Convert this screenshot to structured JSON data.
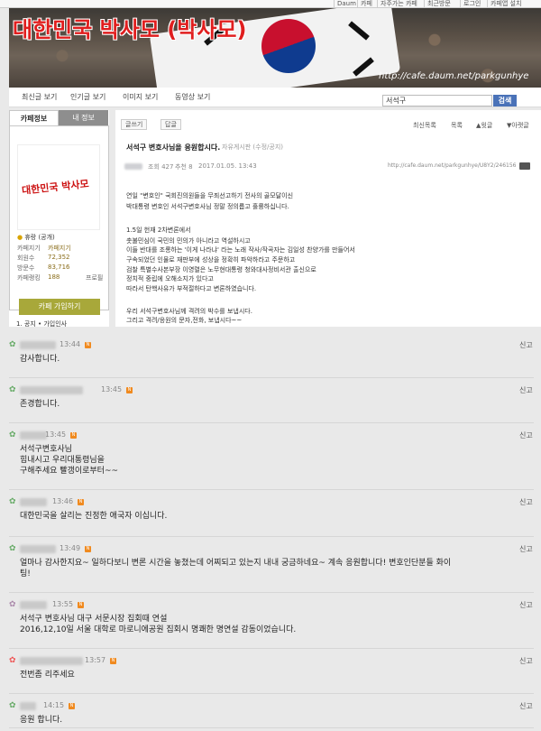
{
  "topbar": {
    "links": [
      "Daum",
      "카페",
      "자주가는 카페",
      "최근방문",
      "로그인",
      "카페앱 설치"
    ]
  },
  "banner": {
    "title": "대한민국 박사모 (박사모)",
    "url": "http://cafe.daum.net/parkgunhye"
  },
  "tabs": [
    "최신글 보기",
    "인기글 보기",
    "이미지 보기",
    "동영상 보기"
  ],
  "search": {
    "value": "서석구",
    "button": "검색"
  },
  "sidebar": {
    "tab_info": "카페정보",
    "tab_mine": "내 정보",
    "logo_text": "대한민국 박사모",
    "manager": "휴랑 (공개)",
    "rows": [
      {
        "label": "카페지기",
        "value": "카페지기"
      },
      {
        "label": "회원수",
        "value": "72,352"
      },
      {
        "label": "방문수",
        "value": "83,716"
      },
      {
        "label": "카페랭킹",
        "value": "188"
      }
    ],
    "promo": "프로필",
    "join": "카페 가입하기",
    "first_menu": "1. 공지 • 가입인사"
  },
  "post": {
    "write_btn": "글쓰기",
    "reply_btn": "답글",
    "top_links": [
      "최신목록",
      "목록",
      "▲윗글",
      "▼아랫글"
    ],
    "title": "서석구 변호사님을 응원합시다.",
    "category": "자유게시판 (수정/공지)",
    "meta_views": "조회 427",
    "meta_likes": "추천 8",
    "meta_date": "2017.01.05. 13:43",
    "meta_url": "http://cafe.daum.net/parkgunhye/U8Y2/246156",
    "body": [
      "연일 \"변호인\" 국회진의원들을 무죄선고하기 전사의 골모달이신",
      "박대통령 변호인 서석구변호사님 정말 정의롭고 훌륭하십니다.",
      "",
      "1.5일 헌재 2차변론에서",
      "촛불민심이 국민의 민의가 아니라고 역설하시고",
      "이들 반대를 조롱하는 '이게 나라냐' 라는 노래 작사/작곡자는  김일성 찬양가를 만들어서",
      "구속되었던 인물로 재판부에 성상을 정확히 파악하라고 주문하고",
      "검찰 특별수사본부장 이영렬은 노무현대통령 청와대사정비서관 출신으로",
      "정치적 중립에 오해소지가 있다고",
      "따라서 탄핵사유가 부적절하다고 변론하였습니다.",
      "",
      "우리 서석구변호사님께 격려의 박수를 보냅시다.",
      "그리고 격려/응원의 문자,전화, 보냅시다~~"
    ]
  },
  "comments": [
    {
      "time": "13:44",
      "text": [
        "감사합니다."
      ],
      "report": "신고"
    },
    {
      "time": "13:45",
      "text": [
        "존경합니다."
      ],
      "report": "신고"
    },
    {
      "time": "13:45",
      "text": [
        "서석구변호사님",
        "힘내시고 우리대통령님을",
        "구해주세요 빨갱이로부터~~"
      ],
      "report": "신고"
    },
    {
      "time": "13:46",
      "text": [
        "대한민국을 살리는 진정한 애국자 이십니다."
      ],
      "report": "신고"
    },
    {
      "time": "13:49",
      "text": [
        "얼마나 감사한지요~ 일하다보니 변론 시간을 놓쳤는데 어찌되고 있는지 내내 궁금하네요~ 계속 응원합니다! 변호인단분들 화이",
        "팅!"
      ],
      "report": "신고"
    },
    {
      "time": "13:55",
      "text": [
        "서석구 변호사님 대구 서문시장 집회때 연설",
        "2016,12,10일 서울 대학로 마로니에공원 집회시 명쾌한 명연설 감동이었습니다."
      ],
      "report": "신고"
    },
    {
      "time": "13:57",
      "text": [
        "전번좀 리주세요"
      ],
      "report": "신고"
    },
    {
      "time": "14:15",
      "text": [
        "응원 합니다."
      ],
      "report": "신고"
    }
  ]
}
